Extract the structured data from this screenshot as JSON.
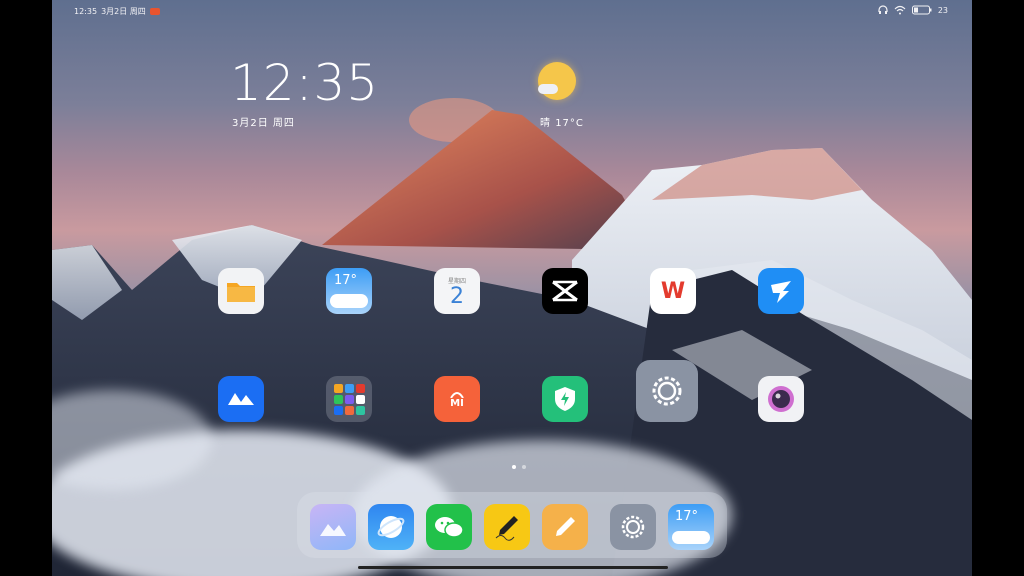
{
  "status_bar": {
    "time": "12:35",
    "date": "3月2日 周四",
    "battery": "23"
  },
  "clock_widget": {
    "time": "12:35",
    "date": "3月2日 周四"
  },
  "weather_widget": {
    "condition": "晴",
    "temperature": "17°C"
  },
  "apps_row1": [
    {
      "name": "files",
      "label": ""
    },
    {
      "name": "weather",
      "label": "17°"
    },
    {
      "name": "calendar",
      "label": "2",
      "sub": "星期四"
    },
    {
      "name": "capcut",
      "label": ""
    },
    {
      "name": "wps-office",
      "label": "W"
    },
    {
      "name": "dingtalk",
      "label": ""
    }
  ],
  "apps_row2": [
    {
      "name": "meeting",
      "label": ""
    },
    {
      "name": "app-folder",
      "label": ""
    },
    {
      "name": "mi-store",
      "label": "MI"
    },
    {
      "name": "security",
      "label": ""
    },
    {
      "name": "settings",
      "label": ""
    },
    {
      "name": "camera",
      "label": ""
    }
  ],
  "dock_apps": [
    {
      "name": "gallery"
    },
    {
      "name": "browser"
    },
    {
      "name": "wechat"
    },
    {
      "name": "notes-sign"
    },
    {
      "name": "notes"
    },
    {
      "name": "settings"
    },
    {
      "name": "weather",
      "label": "17°"
    }
  ]
}
